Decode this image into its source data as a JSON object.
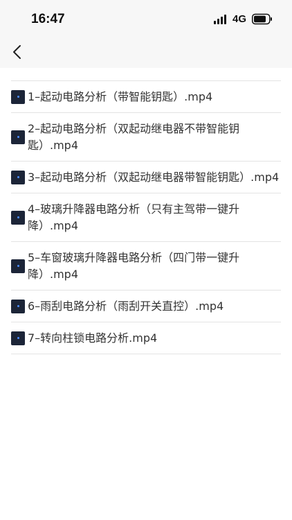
{
  "status": {
    "time": "16:47",
    "network": "4G",
    "battery_icon": "battery-icon",
    "signal_icon": "signal-bars-icon"
  },
  "nav": {
    "back_icon": "chevron-left-icon"
  },
  "files": [
    {
      "name": "1–起动电路分析（带智能钥匙）.mp4",
      "icon": "video-thumbnail-icon"
    },
    {
      "name": "2–起动电路分析（双起动继电器不带智能钥匙）.mp4",
      "icon": "video-thumbnail-icon"
    },
    {
      "name": "3–起动电路分析（双起动继电器带智能钥匙）.mp4",
      "icon": "video-thumbnail-icon"
    },
    {
      "name": "4–玻璃升降器电路分析（只有主驾带一键升降）.mp4",
      "icon": "video-thumbnail-icon"
    },
    {
      "name": "5–车窗玻璃升降器电路分析（四门带一键升降）.mp4",
      "icon": "video-thumbnail-icon"
    },
    {
      "name": "6–雨刮电路分析（雨刮开关直控）.mp4",
      "icon": "video-thumbnail-icon"
    },
    {
      "name": "7–转向柱锁电路分析.mp4",
      "icon": "video-thumbnail-icon"
    }
  ]
}
